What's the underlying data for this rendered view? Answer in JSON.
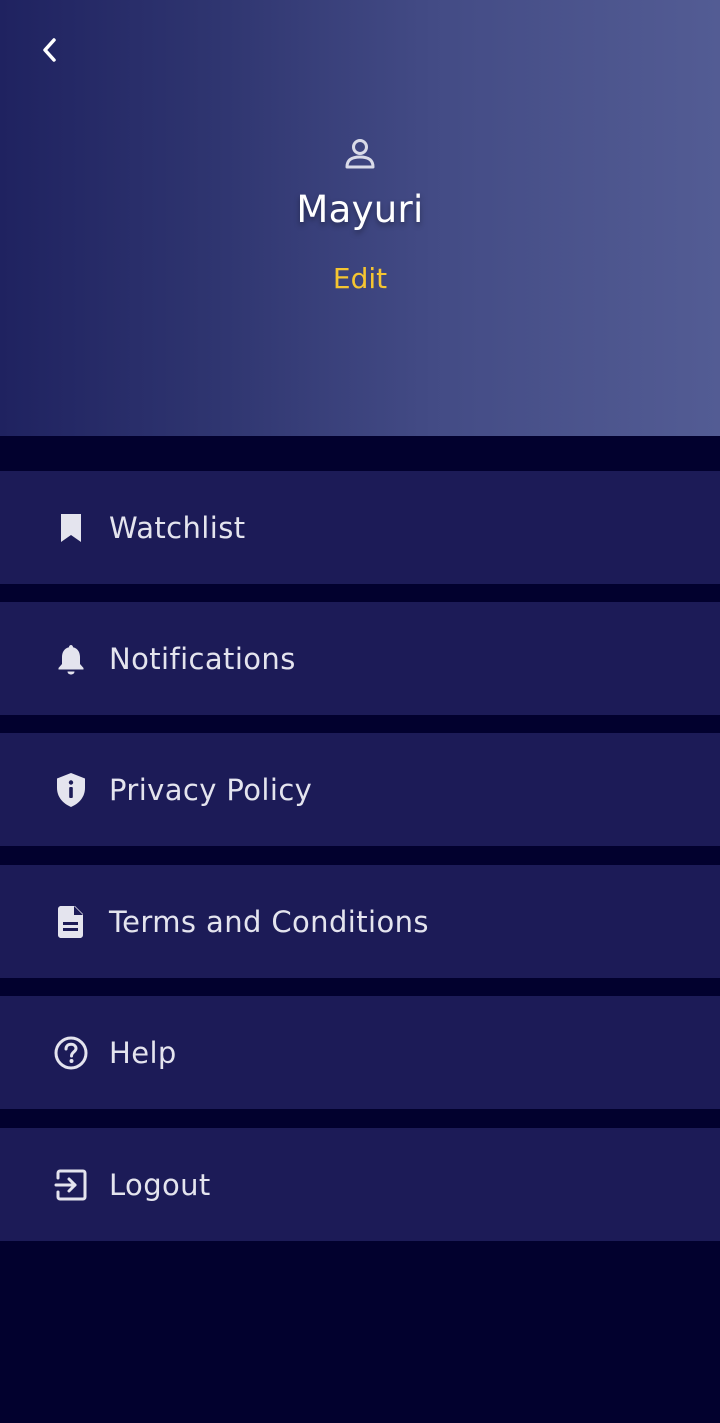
{
  "header": {
    "back_icon": "chevron-left-icon",
    "avatar_icon": "person-outline-icon",
    "name": "Mayuri",
    "edit_label": "Edit",
    "edit_color": "#f5c531"
  },
  "menu": {
    "items": [
      {
        "label": "Watchlist",
        "icon": "bookmark-icon"
      },
      {
        "label": "Notifications",
        "icon": "bell-icon"
      },
      {
        "label": "Privacy Policy",
        "icon": "shield-info-icon"
      },
      {
        "label": "Terms and Conditions",
        "icon": "document-icon"
      },
      {
        "label": "Help",
        "icon": "help-circle-icon"
      },
      {
        "label": "Logout",
        "icon": "logout-icon"
      }
    ]
  },
  "colors": {
    "background": "#02012e",
    "menu_item_background": "#1c1b57",
    "accent": "#f5c531"
  }
}
